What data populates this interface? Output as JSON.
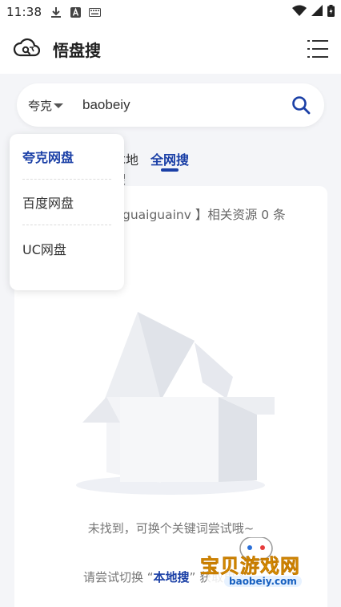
{
  "status_bar": {
    "time": "11:38",
    "left_icons": [
      "download-icon",
      "a-icon",
      "keyboard-icon"
    ],
    "right_icons": [
      "wifi-icon",
      "signal-icon",
      "battery-icon"
    ]
  },
  "header": {
    "title": "悟盘搜",
    "logo_icon": "cloud-search-icon",
    "menu_icon": "menu-icon"
  },
  "search": {
    "engine_selected": "夸克",
    "query": "baobeiy",
    "search_icon": "search-icon"
  },
  "tabs": [
    {
      "label": "本地搜"
    },
    {
      "label": "全网搜",
      "active": true
    }
  ],
  "dropdown": {
    "items": [
      {
        "label": "夸克网盘",
        "active": true
      },
      {
        "label": "百度网盘"
      },
      {
        "label": "UC网盘"
      }
    ]
  },
  "results": {
    "summary": "guaiguainv 】相关资源 0 条",
    "empty_text": "未找到，可换个关键词尝试哦~",
    "hint_prefix": "请尝试切换 “",
    "hint_link": "本地搜",
    "hint_suffix": "” 获取更多"
  },
  "watermark": {
    "text": "宝贝游戏网",
    "url": "baobeiy.com"
  },
  "colors": {
    "accent": "#1a3fa6",
    "background": "#f4f5f8"
  }
}
